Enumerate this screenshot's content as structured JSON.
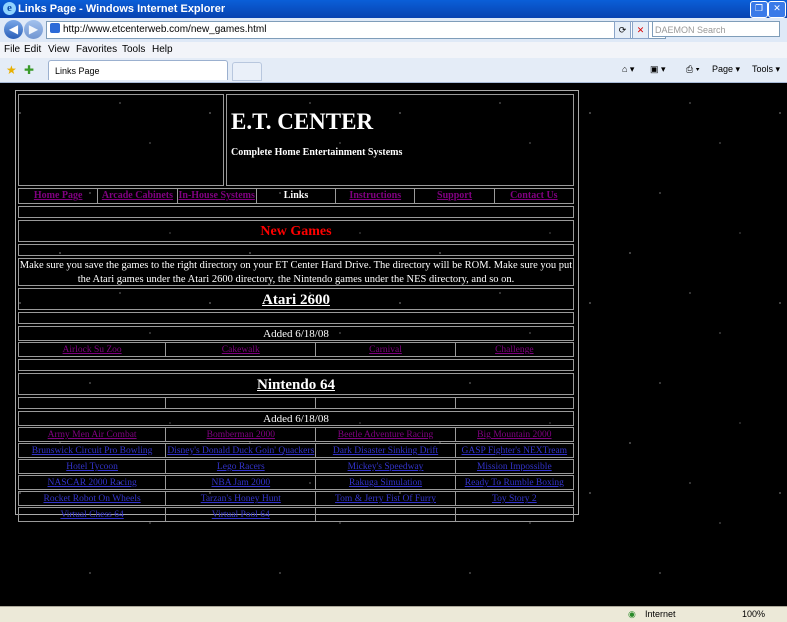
{
  "window": {
    "title": "Links Page - Windows Internet Explorer"
  },
  "address_bar": {
    "url": "http://www.etcenterweb.com/new_games.html",
    "search_placeholder": "DAEMON Search"
  },
  "menu": [
    "File",
    "Edit",
    "View",
    "Favorites",
    "Tools",
    "Help"
  ],
  "tab": {
    "title": "Links Page"
  },
  "command_bar": {
    "page": "Page",
    "tools": "Tools"
  },
  "site": {
    "logo": "E.T. CENTER",
    "tagline": "Complete Home Entertainment Systems",
    "nav": [
      "Home Page",
      "Arcade Cabinets",
      "In-House Systems",
      "Links",
      "Instructions",
      "Support",
      "Contact Us"
    ],
    "current_nav": "Links",
    "heading": "New Games",
    "intro": "Make sure you save the games to the right directory on your ET Center Hard Drive. The directory will be ROM. Make sure you put the Atari games under the Atari 2600 directory, the Nintendo games under the NES directory, and so on.",
    "sections": [
      {
        "title": "Atari 2600",
        "added": "Added 6/18/08",
        "games": [
          [
            "Airlock Su Zoo",
            "Cakewalk",
            "Carnival",
            "Challenge"
          ]
        ]
      },
      {
        "title": "Nintendo 64",
        "added": "Added 6/18/08",
        "games": [
          [
            "Army Men Air Combat",
            "Beetle Adventure Racing",
            "Bomberman 2000",
            "Big Mountain 2000"
          ],
          [
            "Brunswick Circuit Pro Bowling",
            "Disney's Donald Duck Goin' Quackers",
            "Dark Disaster Sinking Drift",
            "GASP Fighter's NEXTream"
          ],
          [
            "Hotel Tycoon",
            "Lego Racers",
            "Mickey's Speedway",
            "Mission Impossible"
          ],
          [
            "NASCAR 2000 Racing",
            "NBA Jam 2000",
            "Rakuga Simulation",
            "Ready To Rumble Boxing"
          ],
          [
            "Rocket Robot On Wheels",
            "Tarzan's Honey Hunt",
            "Tom & Jerry Fist Of Furry",
            "Toy Story 2"
          ],
          [
            "Virtual Chess 64",
            "Virtual Pool 64",
            "",
            ""
          ]
        ]
      }
    ]
  },
  "status": {
    "zone": "Internet",
    "zoom": "100%"
  }
}
